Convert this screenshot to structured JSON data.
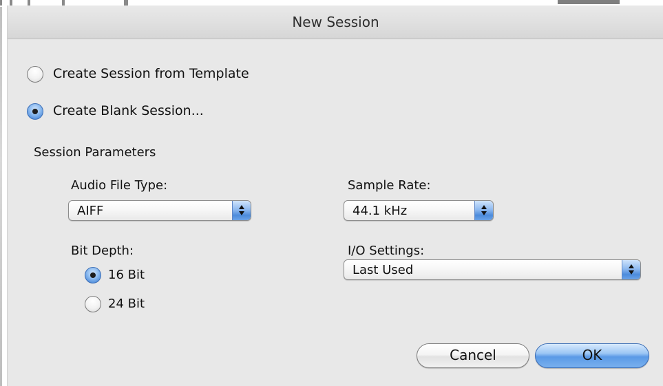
{
  "window": {
    "title": "New Session"
  },
  "session_mode": {
    "template_label": "Create Session from Template",
    "template_selected": false,
    "blank_label": "Create Blank Session...",
    "blank_selected": true
  },
  "parameters": {
    "heading": "Session Parameters",
    "audio_file_type": {
      "label": "Audio File Type:",
      "value": "AIFF"
    },
    "sample_rate": {
      "label": "Sample Rate:",
      "value": "44.1 kHz"
    },
    "bit_depth": {
      "label": "Bit Depth:",
      "options": [
        {
          "label": "16 Bit",
          "selected": true
        },
        {
          "label": "24 Bit",
          "selected": false
        }
      ]
    },
    "io_settings": {
      "label": "I/O Settings:",
      "value": "Last Used"
    }
  },
  "buttons": {
    "cancel_label": "Cancel",
    "ok_label": "OK"
  },
  "colors": {
    "accent_blue": "#5b9ae6",
    "dialog_background": "#e8e8e8"
  }
}
